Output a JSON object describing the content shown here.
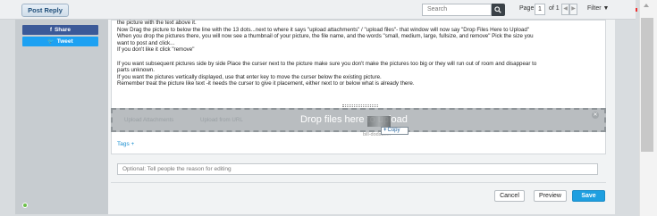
{
  "toolbar": {
    "post_reply": "Post Reply",
    "search_placeholder": "Search",
    "page_label": "Page",
    "page_value": "1",
    "page_of": "of 1",
    "prev": "◀",
    "next": "▶",
    "filter": "Filter ▼"
  },
  "social": {
    "share": "Share",
    "tweet": "Tweet",
    "share_icon": "f",
    "tweet_icon": "🐦"
  },
  "editor": {
    "lines": [
      "the picture with the text above it.",
      "Now Drag the picture to below the line with the 13 dots...next to where it says \"upload attachments\" / \"upload files\"- that window will now say \"Drop Files Here to Upload\"",
      "When you drop the pictures there, you will now see a thumbnail of your picture, the file name, and the words \"small, medium, large, fullsize, and remove\" Pick the size you",
      "want to post and click...",
      "If you don't like it click \"remove\"",
      "",
      "If you want subsequent pictures side by side Place the curser next to the picture make sure you don't make the pictures too big or they will run out of room and disappear to",
      "parts unknown.",
      "If you want the pictures vertically displayed, use that enter key to move the curser below the existing picture.",
      "Remember treat the picture like text -it needs the curser to give it placement, either next to or below what is already there."
    ]
  },
  "dropzone": {
    "upload_attachments": "Upload Attachments",
    "upload_from_url": "Upload from URL",
    "message": "Drop files here to upload",
    "dragged_filename": "bill-dodson...",
    "copy_badge": "Copy",
    "close": "✕"
  },
  "tags_label": "Tags +",
  "edit_reason_placeholder": "Optional: Tell people the reason for editing",
  "actions": {
    "cancel": "Cancel",
    "preview": "Preview",
    "save": "Save"
  },
  "colors": {
    "save": "#1e9fe0",
    "facebook": "#3b5998",
    "twitter": "#1da1f2",
    "online": "#6cc04a"
  }
}
